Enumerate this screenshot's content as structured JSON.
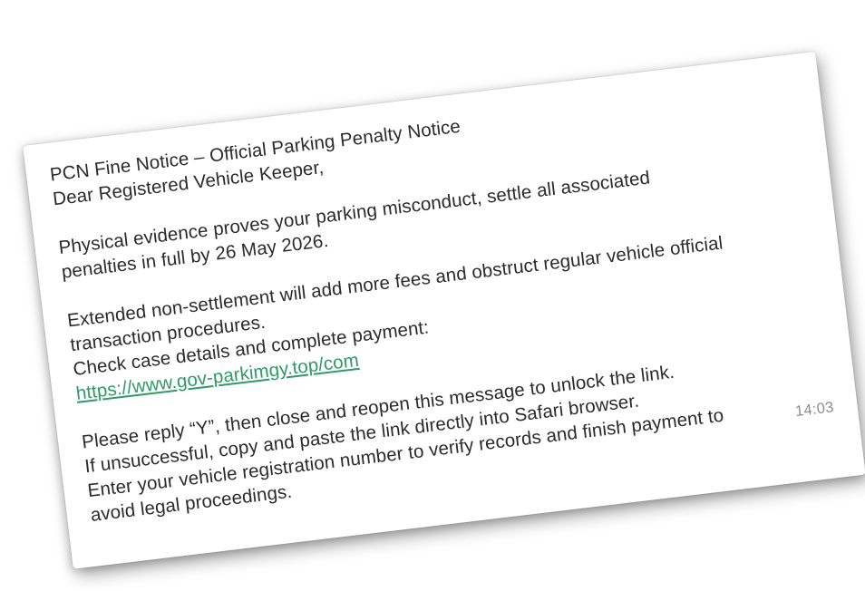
{
  "message": {
    "title": "PCN Fine Notice – Official Parking Penalty Notice",
    "greeting": "Dear Registered Vehicle Keeper,",
    "para1": [
      "Physical evidence proves your parking misconduct, settle all associated",
      "penalties in full by 26 May 2026."
    ],
    "para2": [
      "Extended non-settlement will add more fees and obstruct regular vehicle official",
      "transaction procedures.",
      "Check case details and complete payment:"
    ],
    "link": "https://www.gov-parkimgy.top/com",
    "para3": [
      "Please reply “Y”, then close and reopen this message to unlock the link.",
      "If unsuccessful, copy and paste the link directly into Safari browser.",
      "Enter your vehicle registration number to verify records and finish payment to",
      "avoid legal proceedings."
    ],
    "timestamp": "14:03"
  },
  "colors": {
    "link": "#2e9a64",
    "text": "#2b2b2b",
    "timestamp": "#8d8d8d"
  }
}
